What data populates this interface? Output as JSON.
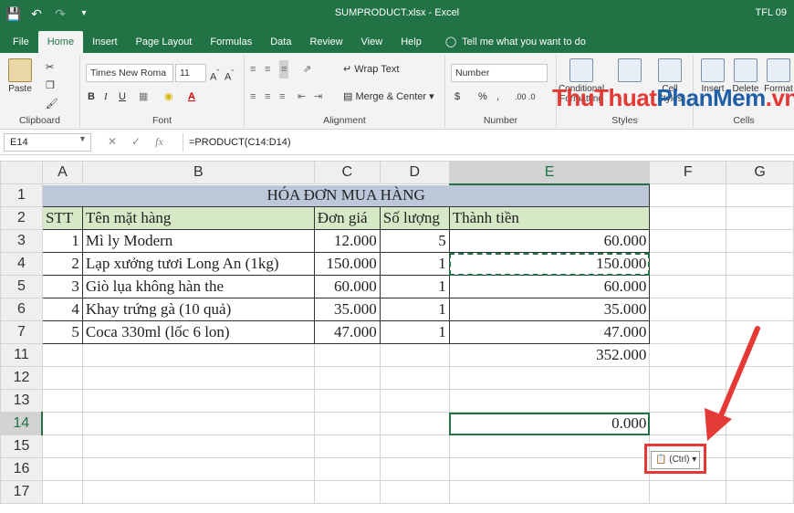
{
  "titlebar": {
    "title": "SUMPRODUCT.xlsx - Excel",
    "user": "TFL 09"
  },
  "tabs": [
    "File",
    "Home",
    "Insert",
    "Page Layout",
    "Formulas",
    "Data",
    "Review",
    "View",
    "Help"
  ],
  "tellme": "Tell me what you want to do",
  "ribbon": {
    "paste": "Paste",
    "font_name": "Times New Roma",
    "font_size": "11",
    "wrap_text": "Wrap Text",
    "merge_center": "Merge & Center",
    "number_format": "Number",
    "currency": "$",
    "percent": "%",
    "comma": ",",
    "inc_dec": ".00 .0",
    "cond_format": "Conditional Formatting",
    "styles_cell": "Cell Styles",
    "insert": "Insert",
    "delete": "Delete",
    "format": "Format",
    "groups": {
      "clipboard": "Clipboard",
      "font": "Font",
      "alignment": "Alignment",
      "number": "Number",
      "styles": "Styles",
      "cells": "Cells"
    }
  },
  "formula_bar": {
    "name_box": "E14",
    "formula": "=PRODUCT(C14:D14)"
  },
  "columns": [
    "A",
    "B",
    "C",
    "D",
    "E",
    "F",
    "G"
  ],
  "rows": [
    {
      "num": "1",
      "cells": [
        "HÓA ĐƠN MUA HÀNG"
      ]
    },
    {
      "num": "2",
      "cells": [
        "STT",
        "Tên mặt hàng",
        "Đơn giá",
        "Số lượng",
        "Thành tiền",
        "",
        ""
      ]
    },
    {
      "num": "3",
      "cells": [
        "1",
        "Mì ly Modern",
        "12.000",
        "5",
        "60.000",
        "",
        ""
      ]
    },
    {
      "num": "4",
      "cells": [
        "2",
        "Lạp xưởng tươi Long An (1kg)",
        "150.000",
        "1",
        "150.000",
        "",
        ""
      ]
    },
    {
      "num": "5",
      "cells": [
        "3",
        "Giò lụa không hàn the",
        "60.000",
        "1",
        "60.000",
        "",
        ""
      ]
    },
    {
      "num": "6",
      "cells": [
        "4",
        "Khay trứng gà (10 quả)",
        "35.000",
        "1",
        "35.000",
        "",
        ""
      ]
    },
    {
      "num": "7",
      "cells": [
        "5",
        "Coca 330ml (lốc 6 lon)",
        "47.000",
        "1",
        "47.000",
        "",
        ""
      ]
    },
    {
      "num": "11",
      "cells": [
        "",
        "",
        "",
        "",
        "352.000",
        "",
        ""
      ]
    },
    {
      "num": "12",
      "cells": [
        "",
        "",
        "",
        "",
        "",
        "",
        ""
      ]
    },
    {
      "num": "13",
      "cells": [
        "",
        "",
        "",
        "",
        "",
        "",
        ""
      ]
    },
    {
      "num": "14",
      "cells": [
        "",
        "",
        "",
        "",
        "0.000",
        "",
        ""
      ]
    },
    {
      "num": "15",
      "cells": [
        "",
        "",
        "",
        "",
        "",
        "",
        ""
      ]
    },
    {
      "num": "16",
      "cells": [
        "",
        "",
        "",
        "",
        "",
        "",
        ""
      ]
    },
    {
      "num": "17",
      "cells": [
        "",
        "",
        "",
        "",
        "",
        "",
        ""
      ]
    }
  ],
  "paste_options": "(Ctrl)",
  "watermark": {
    "part1": "ThuThuat",
    "part2": "PhanMem",
    "part3": ".vn"
  },
  "colors": {
    "excel_green": "#217346",
    "header_fill": "#d6e9c6",
    "title_fill": "#bcc8d9",
    "callout_red": "#e53935"
  }
}
